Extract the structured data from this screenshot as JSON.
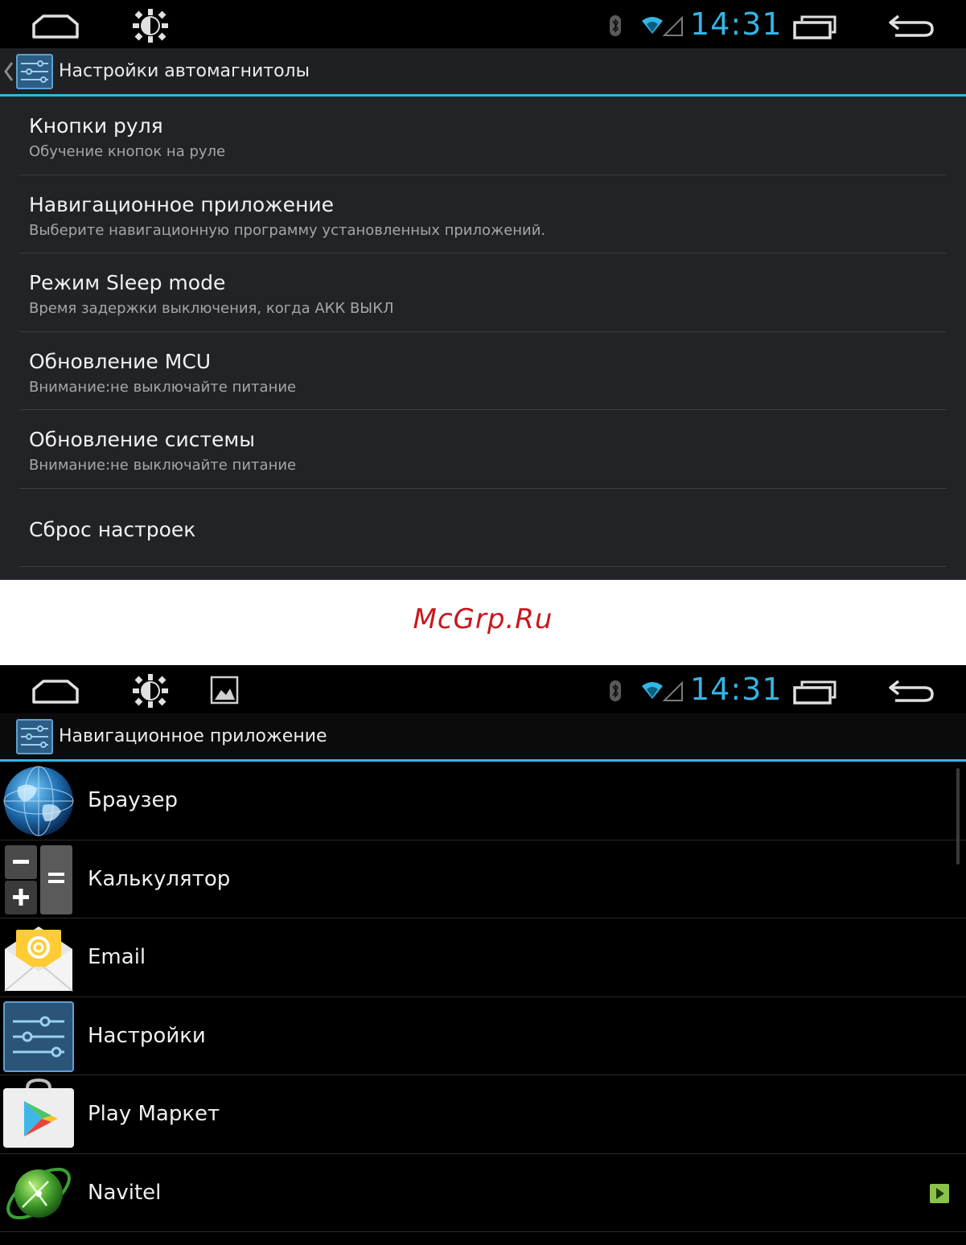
{
  "status_bar": {
    "time": "14:31"
  },
  "screen1": {
    "header_title": "Настройки автомагнитолы",
    "items": [
      {
        "title": "Кнопки руля",
        "summary": "Обучение кнопок на руле"
      },
      {
        "title": "Навигационное приложение",
        "summary": "Выберите навигационную программу установленных приложений."
      },
      {
        "title": "Режим Sleep mode",
        "summary": "Время задержки выключения, когда АКК ВЫКЛ"
      },
      {
        "title": "Обновление MCU",
        "summary": "Внимание:не выключайте питание"
      },
      {
        "title": "Обновление системы",
        "summary": "Внимание:не выключайте питание"
      },
      {
        "title": "Сброс настроек",
        "summary": ""
      }
    ]
  },
  "watermark": "McGrp.Ru",
  "screen2": {
    "header_title": "Навигационное приложение",
    "apps": [
      {
        "label": "Браузер",
        "icon": "globe-icon"
      },
      {
        "label": "Калькулятор",
        "icon": "calculator-icon"
      },
      {
        "label": "Email",
        "icon": "email-icon"
      },
      {
        "label": "Настройки",
        "icon": "settings-icon"
      },
      {
        "label": "Play Маркет",
        "icon": "play-store-icon"
      },
      {
        "label": "Navitel",
        "icon": "navitel-icon"
      }
    ]
  },
  "colors": {
    "accent": "#33b5e5",
    "watermark": "#c8171d",
    "badge": "#8bc34a"
  }
}
